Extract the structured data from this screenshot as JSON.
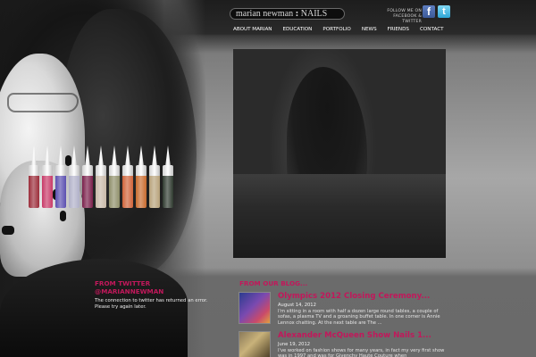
{
  "header": {
    "logo_left": "marian newman",
    "logo_separator": ":",
    "logo_right": "NAILS",
    "follow_line1": "FOLLOW ME ON",
    "follow_line2": "FACEBOOK & TWITTER",
    "facebook_icon_glyph": "f",
    "twitter_icon_glyph": "t"
  },
  "nav": {
    "items": [
      {
        "label": "ABOUT MARIAN"
      },
      {
        "label": "EDUCATION"
      },
      {
        "label": "PORTFOLIO"
      },
      {
        "label": "NEWS"
      },
      {
        "label": "FRIENDS"
      },
      {
        "label": "CONTACT"
      }
    ]
  },
  "twitter": {
    "heading_line1": "FROM TWITTER",
    "heading_line2": "@MARIANNEWMAN",
    "message": "The connection to twitter has returned an error. Please try again later."
  },
  "blog": {
    "heading": "FROM OUR BLOG...",
    "posts": [
      {
        "title": "Olympics 2012 Closing Ceremony...",
        "date": "August 14, 2012",
        "excerpt": "I'm sitting in a room with half a dozen large round tables, a couple of sofas, a plasma TV and a groaning buffet table. In one corner is Annie Lennox chatting. At the next table are The ..."
      },
      {
        "title": "Alexander McQueen Show Nails 1...",
        "date": "June 19, 2012",
        "excerpt": "I've worked on fashion shows for many years, in fact my very first show was in 1997 and was for Givenchy Haute Couture when"
      }
    ]
  },
  "colors": {
    "accent": "#c2185b",
    "bottles": [
      "#9b2d3a",
      "#c83a68",
      "#5b4fb0",
      "#b0b0c8",
      "#7a1f4a",
      "#c8b9a8",
      "#8f8f6a",
      "#d0643a",
      "#c86b2e",
      "#b7a27a",
      "#2f3a2f"
    ]
  }
}
